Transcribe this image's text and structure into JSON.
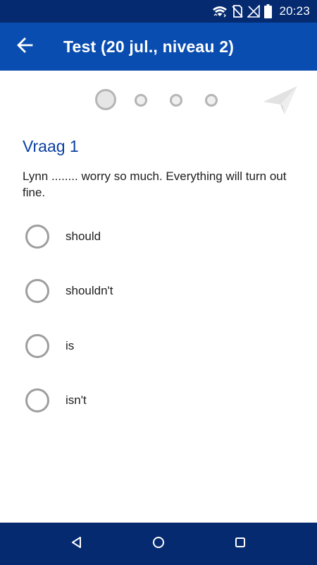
{
  "status_bar": {
    "time": "20:23",
    "icons": [
      "wifi-icon",
      "no-sim-icon",
      "signal-off-icon",
      "battery-icon"
    ]
  },
  "app_bar": {
    "title": "Test (20 jul., niveau 2)",
    "back_icon": "arrow-left-icon"
  },
  "stepper": {
    "total_steps": 4,
    "current_step": 1,
    "send_icon": "paper-plane-icon"
  },
  "question": {
    "title": "Vraag 1",
    "text": "Lynn ........ worry so much. Everything will turn out fine.",
    "options": [
      {
        "label": "should"
      },
      {
        "label": "shouldn't"
      },
      {
        "label": "is"
      },
      {
        "label": "isn't"
      }
    ],
    "selected_option": null
  },
  "nav_bar": {
    "icons": [
      "nav-back-icon",
      "nav-home-icon",
      "nav-recents-icon"
    ]
  },
  "colors": {
    "status_bar": "#052a70",
    "app_bar": "#0a4db0",
    "question_title": "#0a3fa0",
    "nav_bar": "#052a70"
  }
}
